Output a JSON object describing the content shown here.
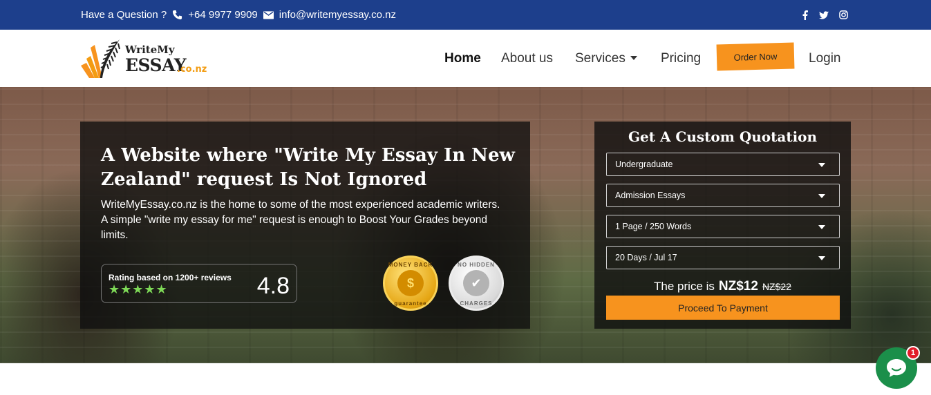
{
  "topbar": {
    "question": "Have a Question ?",
    "phone": "+64 9977 9909",
    "email": "info@writemyessay.co.nz",
    "social_icons": [
      "facebook-icon",
      "twitter-icon",
      "instagram-icon"
    ]
  },
  "logo": {
    "line1": "WriteMy",
    "line2": "ESSAY",
    "suffix": ".co.nz"
  },
  "nav": {
    "home": "Home",
    "about": "About us",
    "services": "Services",
    "pricing": "Pricing",
    "order": "Order Now",
    "login": "Login"
  },
  "hero": {
    "title": "A Website where \"Write My Essay In New Zealand\" request Is Not Ignored",
    "description": "WriteMyEssay.co.nz is the home to some of the most experienced academic writers. A simple \"write my essay for me\" request is enough to Boost Your Grades beyond limits.",
    "rating_label": "Rating based on 1200+ reviews",
    "stars": "★★★★★",
    "rating_score": "4.8",
    "badge_gold_top": "MONEY BACK",
    "badge_gold_bottom": "guarantee",
    "badge_silver_top": "NO HIDDEN",
    "badge_silver_bottom": "CHARGES"
  },
  "quote": {
    "title": "Get A Custom Quotation",
    "level": "Undergraduate",
    "type": "Admission Essays",
    "pages": "1 Page / 250 Words",
    "deadline": "20 Days / Jul 17",
    "price_label": "The price is",
    "price": "NZ$12",
    "old_price": "NZ$22",
    "button": "Proceed To Payment"
  },
  "chat": {
    "notification_count": "1"
  },
  "colors": {
    "topbar": "#1d3f8c",
    "accent": "#f7931e",
    "stars": "#7ed957",
    "chat": "#1b8f4a"
  }
}
